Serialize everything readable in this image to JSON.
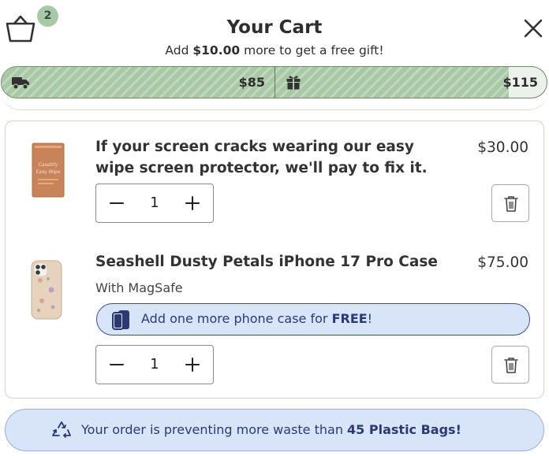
{
  "header": {
    "title": "Your Cart",
    "cart_count": "2",
    "subtitle_prefix": "Add ",
    "subtitle_amount": "$10.00",
    "subtitle_suffix": " more to get a free gift!"
  },
  "progress": {
    "milestone_1_label": "$85",
    "milestone_2_label": "$115",
    "fill_fraction": 0.93,
    "fill_color": "#a9c8a5"
  },
  "items": [
    {
      "title_line1": "If your screen cracks wearing our easy",
      "title_line2": "wipe screen protector, we'll pay to fix it.",
      "price": "$30.00",
      "quantity": "1",
      "thumbnail_text_line1": "Casetify",
      "thumbnail_text_line2": "Easy Wipe"
    },
    {
      "title": "Seashell Dusty Petals iPhone 17 Pro Case",
      "variant": "With MagSafe",
      "price": "$75.00",
      "quantity": "1",
      "promo_prefix": "Add one more phone case for ",
      "promo_bold": "FREE",
      "promo_suffix": "!"
    }
  ],
  "eco_banner": {
    "prefix": "Your order is preventing more waste than ",
    "bold": "45 Plastic Bags!"
  },
  "icons": {
    "cart": "basket-icon",
    "close": "close-icon",
    "shipping": "truck-icon",
    "gift": "gift-icon",
    "trash": "trash-icon",
    "phone": "phone-case-icon",
    "recycle": "recycle-icon"
  },
  "colors": {
    "accent_green": "#a9c8a5",
    "badge_green": "#a7c9a6",
    "promo_blue_bg": "#d8e5f8",
    "promo_blue_text": "#2b3a75"
  }
}
